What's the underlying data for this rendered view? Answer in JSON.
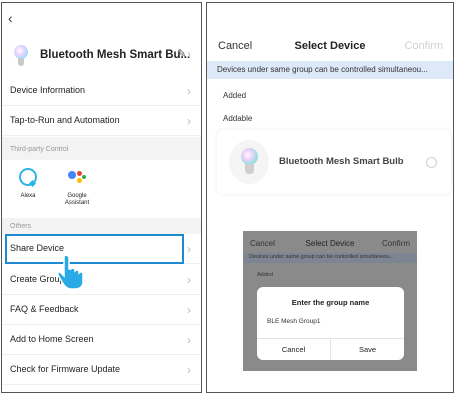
{
  "left": {
    "back_glyph": "‹",
    "device_name": "Bluetooth Mesh Smart Bu...",
    "items": [
      {
        "label": "Device Information"
      },
      {
        "label": "Tap-to-Run and Automation"
      }
    ],
    "third_party_section": "Third-party Control",
    "apps": [
      {
        "label": "Alexa",
        "icon": "alexa-icon"
      },
      {
        "label": "Google Assistant",
        "icon": "google-assistant-icon"
      }
    ],
    "others_section": "Others",
    "others_items": [
      {
        "label": "Share Device"
      },
      {
        "label": "Create Group"
      },
      {
        "label": "FAQ & Feedback"
      },
      {
        "label": "Add to Home Screen"
      },
      {
        "label": "Check for Firmware Update"
      }
    ],
    "highlight_color": "#1d8ad4"
  },
  "right": {
    "cancel": "Cancel",
    "title": "Select Device",
    "confirm": "Confirm",
    "banner": "Devices under same group can be controlled simultaneou...",
    "added": "Added",
    "addable": "Addable",
    "device_name": "Bluetooth Mesh Smart Bulb",
    "banner_color": "#dde9f8"
  },
  "inset": {
    "cancel": "Cancel",
    "title": "Select Device",
    "confirm": "Confirm",
    "banner": "Devices under same group can be controlled simultaneou...",
    "added": "Added",
    "dialog": {
      "title": "Enter the group name",
      "input_value": "BLE Mesh Group1",
      "cancel": "Cancel",
      "save": "Save"
    }
  }
}
